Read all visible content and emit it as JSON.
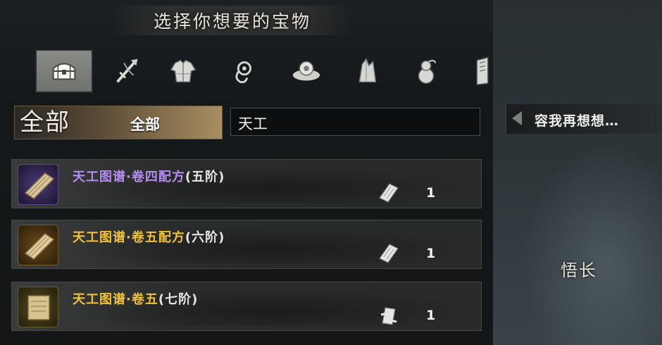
{
  "header": {
    "title": "选择你想要的宝物"
  },
  "tabs": [
    {
      "icon": "treasure-chest-icon",
      "active": true
    },
    {
      "icon": "weapon-icon",
      "active": false
    },
    {
      "icon": "armor-icon",
      "active": false
    },
    {
      "icon": "accessory-icon",
      "active": false
    },
    {
      "icon": "orb-icon",
      "active": false
    },
    {
      "icon": "crystal-icon",
      "active": false
    },
    {
      "icon": "gourd-icon",
      "active": false
    },
    {
      "icon": "book-icon",
      "active": false
    }
  ],
  "filter": {
    "category_big": "全部",
    "category_selected": "全部",
    "search_value": "天工"
  },
  "cancel": {
    "label": "容我再想想…"
  },
  "items": [
    {
      "name": "天工图谱·卷四配方",
      "tier": "(五阶)",
      "color": "#b58cf0",
      "qty": "1",
      "qty_icon": "scroll-icon",
      "rarity_bg": "#2a1f4a"
    },
    {
      "name": "天工图谱·卷五配方",
      "tier": "(六阶)",
      "color": "#f0c23c",
      "qty": "1",
      "qty_icon": "scroll-icon",
      "rarity_bg": "#4a3512"
    },
    {
      "name": "天工图谱·卷五",
      "tier": "(七阶)",
      "color": "#f0c23c",
      "qty": "1",
      "qty_icon": "scroll-icon",
      "rarity_bg": "#3e3618"
    }
  ],
  "side": {
    "label": "悟长"
  }
}
